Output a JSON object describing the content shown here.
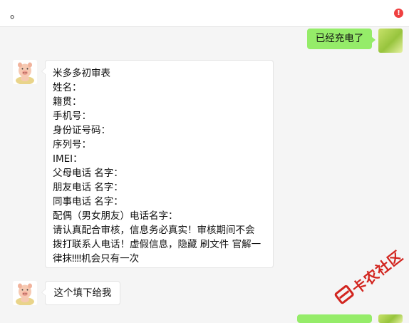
{
  "top_message": {
    "text": "。",
    "warning_symbol": "!"
  },
  "messages": [
    {
      "side": "right",
      "text": "已经充电了"
    },
    {
      "side": "left",
      "lines": [
        "米多多初审表",
        "姓名：",
        "籍贯：",
        "手机号：",
        "身份证号码：",
        "序列号：",
        "IMEI：",
        "父母电话 名字：",
        "朋友电话 名字：",
        "同事电话 名字：",
        "配偶（男女朋友）电话名字：",
        "请认真配合审核，信息务必真实！审核期间不会",
        "拨打联系人电话！虚假信息，隐藏 刷文件 官解一",
        "律抹‼‼机会只有一次"
      ]
    },
    {
      "side": "left",
      "text": "这个填下给我"
    }
  ],
  "watermark": {
    "text": "卡农社区",
    "color": "#d2251f"
  },
  "colors": {
    "sent_bubble": "#95ec69",
    "received_bubble": "#ffffff",
    "background": "#f5f5f5"
  }
}
